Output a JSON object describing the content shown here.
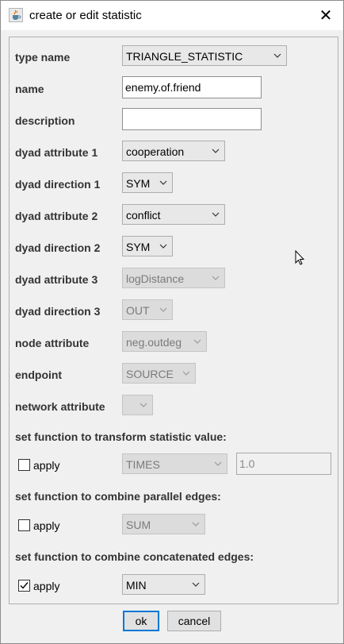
{
  "window": {
    "title": "create or edit statistic",
    "close_glyph": "✕",
    "app_icon": "java-coffee-cup-icon"
  },
  "form": {
    "type_name": {
      "label": "type name",
      "value": "TRIANGLE_STATISTIC"
    },
    "name": {
      "label": "name",
      "value": "enemy.of.friend"
    },
    "description": {
      "label": "description",
      "value": ""
    },
    "dyad_attribute_1": {
      "label": "dyad attribute 1",
      "value": "cooperation"
    },
    "dyad_direction_1": {
      "label": "dyad direction 1",
      "value": "SYM"
    },
    "dyad_attribute_2": {
      "label": "dyad attribute 2",
      "value": "conflict"
    },
    "dyad_direction_2": {
      "label": "dyad direction 2",
      "value": "SYM"
    },
    "dyad_attribute_3": {
      "label": "dyad attribute 3",
      "value": "logDistance",
      "enabled": false
    },
    "dyad_direction_3": {
      "label": "dyad direction 3",
      "value": "OUT",
      "enabled": false
    },
    "node_attribute": {
      "label": "node attribute",
      "value": "neg.outdeg",
      "enabled": false
    },
    "endpoint": {
      "label": "endpoint",
      "value": "SOURCE",
      "enabled": false
    },
    "network_attribute": {
      "label": "network attribute",
      "value": "",
      "enabled": false
    }
  },
  "transform": {
    "heading": "set function to transform statistic value:",
    "apply_label": "apply",
    "apply_checked": false,
    "function": "TIMES",
    "parameter": "1.0"
  },
  "parallel": {
    "heading": "set function to combine parallel edges:",
    "apply_label": "apply",
    "apply_checked": false,
    "function": "SUM"
  },
  "concatenated": {
    "heading": "set function to combine concatenated edges:",
    "apply_label": "apply",
    "apply_checked": true,
    "function": "MIN"
  },
  "buttons": {
    "ok": "ok",
    "cancel": "cancel"
  },
  "colors": {
    "default_button_border": "#0078d7",
    "window_bg": "#f0f0f0"
  }
}
